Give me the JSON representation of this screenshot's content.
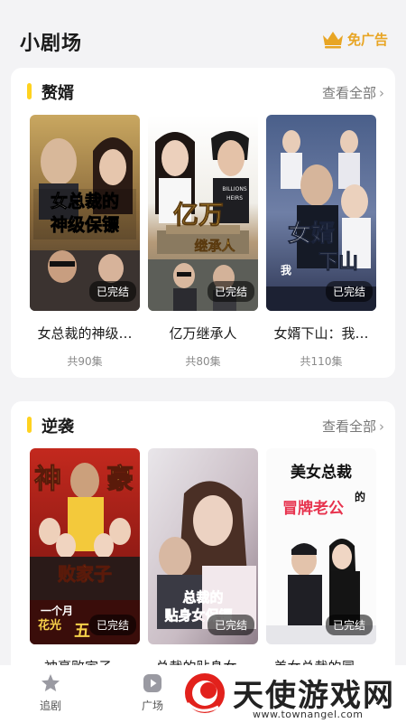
{
  "header": {
    "title": "小剧场",
    "adfree_label": "免广告"
  },
  "sections": [
    {
      "title": "赘婿",
      "more_label": "查看全部",
      "items": [
        {
          "title": "女总裁的神级…",
          "count": "共90集",
          "status": "已完结",
          "poster_text": "女总裁的神级保镖"
        },
        {
          "title": "亿万继承人",
          "count": "共80集",
          "status": "已完结",
          "poster_text": "亿万继承人"
        },
        {
          "title": "女婿下山：我…",
          "count": "共110集",
          "status": "已完结",
          "poster_text": "女婿下山"
        }
      ]
    },
    {
      "title": "逆袭",
      "more_label": "查看全部",
      "items": [
        {
          "title": "神豪败家子…",
          "status": "已完结",
          "poster_text": "神豪败家子"
        },
        {
          "title": "总裁的贴身女…",
          "status": "已完结",
          "poster_text": "总裁的贴身女保镖"
        },
        {
          "title": "美女总裁的冒…",
          "status": "已完结",
          "poster_text": "美女总裁的冒牌老公"
        }
      ]
    }
  ],
  "tabbar": {
    "tabs": [
      {
        "label": "追剧",
        "icon": "star-icon"
      },
      {
        "label": "广场",
        "icon": "play-icon"
      }
    ]
  },
  "watermark": {
    "text": "天使游戏网",
    "url": "www.townangel.com"
  },
  "colors": {
    "accent": "#ffd21f",
    "adfree": "#e8a524",
    "background": "#f3f3f5"
  }
}
